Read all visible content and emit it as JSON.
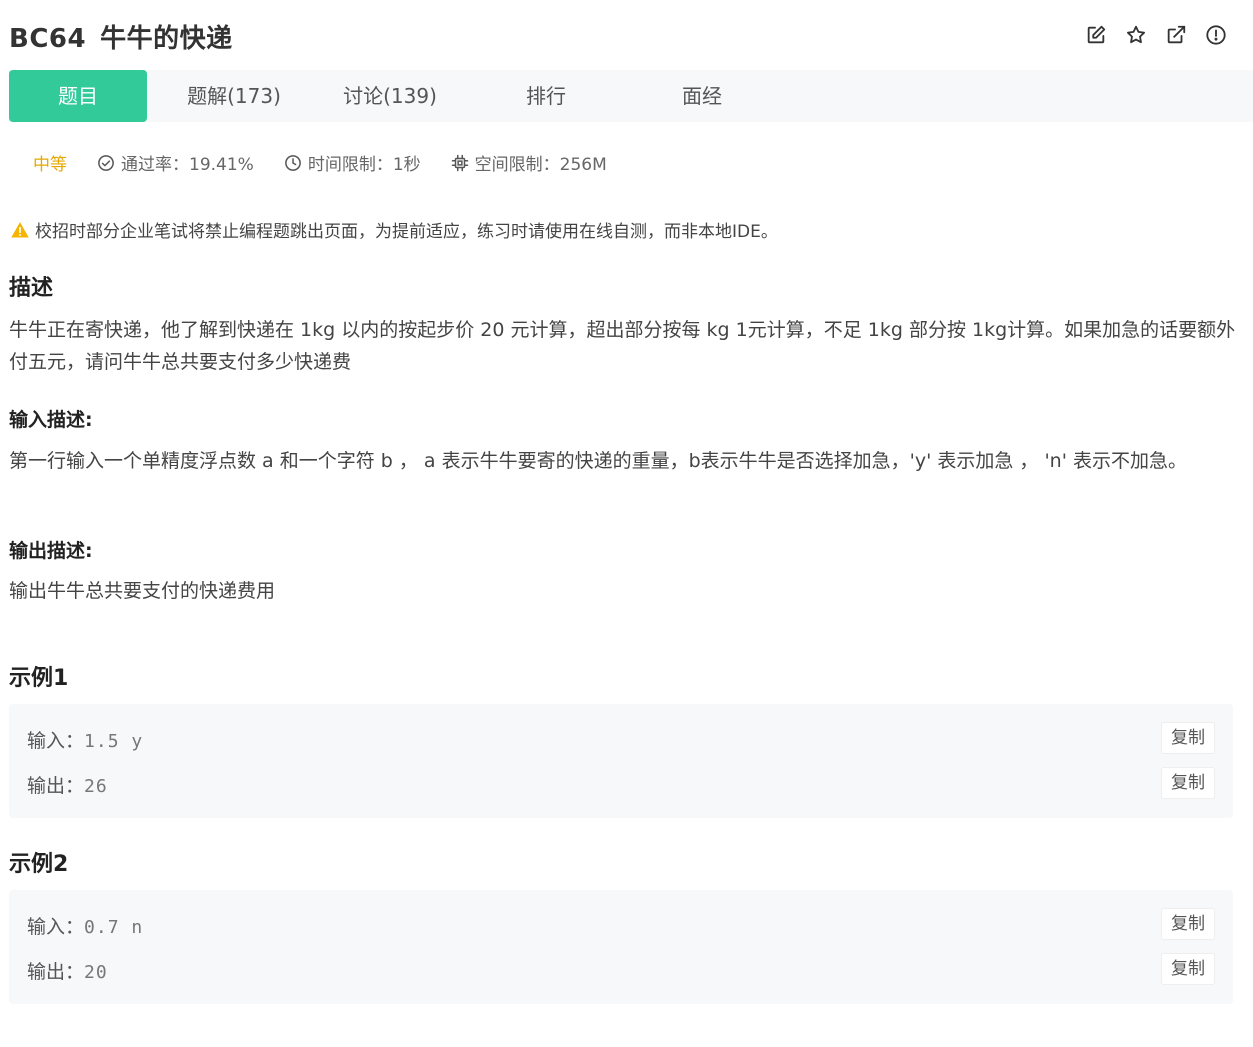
{
  "header": {
    "code": "BC64",
    "title": "牛牛的快递",
    "icons": [
      "edit-icon",
      "star-icon",
      "external-link-icon",
      "alert-circle-icon"
    ]
  },
  "tabs": [
    {
      "label": "题目",
      "active": true
    },
    {
      "label": "题解(173)",
      "active": false
    },
    {
      "label": "讨论(139)",
      "active": false
    },
    {
      "label": "排行",
      "active": false
    },
    {
      "label": "面经",
      "active": false
    }
  ],
  "meta": {
    "difficulty": "中等",
    "pass_rate": "通过率：19.41%",
    "time_limit": "时间限制：1秒",
    "space_limit": "空间限制：256M"
  },
  "notice": "校招时部分企业笔试将禁止编程题跳出页面，为提前适应，练习时请使用在线自测，而非本地IDE。",
  "description": {
    "heading": "描述",
    "text": "牛牛正在寄快递，他了解到快递在 1kg 以内的按起步价 20 元计算，超出部分按每 kg 1元计算，不足 1kg 部分按 1kg计算。如果加急的话要额外付五元，请问牛牛总共要支付多少快递费"
  },
  "input_desc": {
    "heading": "输入描述:",
    "text": "第一行输入一个单精度浮点数 a 和一个字符 b ， a 表示牛牛要寄的快递的重量，b表示牛牛是否选择加急，'y' 表示加急 ， 'n' 表示不加急。"
  },
  "output_desc": {
    "heading": "输出描述:",
    "text": "输出牛牛总共要支付的快递费用"
  },
  "examples": [
    {
      "heading": "示例1",
      "input_label": "输入：",
      "input": "1.5 y",
      "output_label": "输出：",
      "output": "26",
      "copy_label": "复制"
    },
    {
      "heading": "示例2",
      "input_label": "输入：",
      "input": "0.7 n",
      "output_label": "输出：",
      "output": "20",
      "copy_label": "复制"
    }
  ],
  "colors": {
    "accent": "#32ca99",
    "difficulty": "#e6a800",
    "warning": "#f5b400"
  }
}
